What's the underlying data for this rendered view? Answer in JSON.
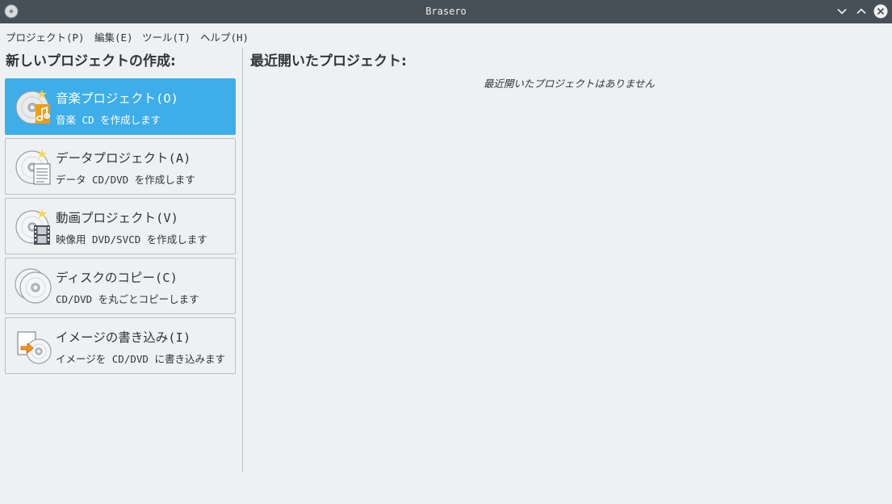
{
  "window": {
    "title": "Brasero"
  },
  "menubar": {
    "items": [
      {
        "label": "プロジェクト(P)"
      },
      {
        "label": "編集(E)"
      },
      {
        "label": "ツール(T)"
      },
      {
        "label": "ヘルプ(H)"
      }
    ]
  },
  "new_project": {
    "heading": "新しいプロジェクトの作成:",
    "items": [
      {
        "title": "音楽プロジェクト(O)",
        "subtitle": "音楽 CD を作成します",
        "icon": "audio-cd-icon"
      },
      {
        "title": "データプロジェクト(A)",
        "subtitle": "データ CD/DVD を作成します",
        "icon": "data-disc-icon"
      },
      {
        "title": "動画プロジェクト(V)",
        "subtitle": "映像用 DVD/SVCD を作成します",
        "icon": "video-disc-icon"
      },
      {
        "title": "ディスクのコピー(C)",
        "subtitle": "CD/DVD を丸ごとコピーします",
        "icon": "copy-disc-icon"
      },
      {
        "title": "イメージの書き込み(I)",
        "subtitle": "イメージを CD/DVD に書き込みます",
        "icon": "burn-image-icon"
      }
    ]
  },
  "recent": {
    "heading": "最近開いたプロジェクト:",
    "empty_message": "最近開いたプロジェクトはありません"
  },
  "colors": {
    "titlebar": "#475057",
    "accent": "#3daee9",
    "background": "#eff0f1"
  }
}
